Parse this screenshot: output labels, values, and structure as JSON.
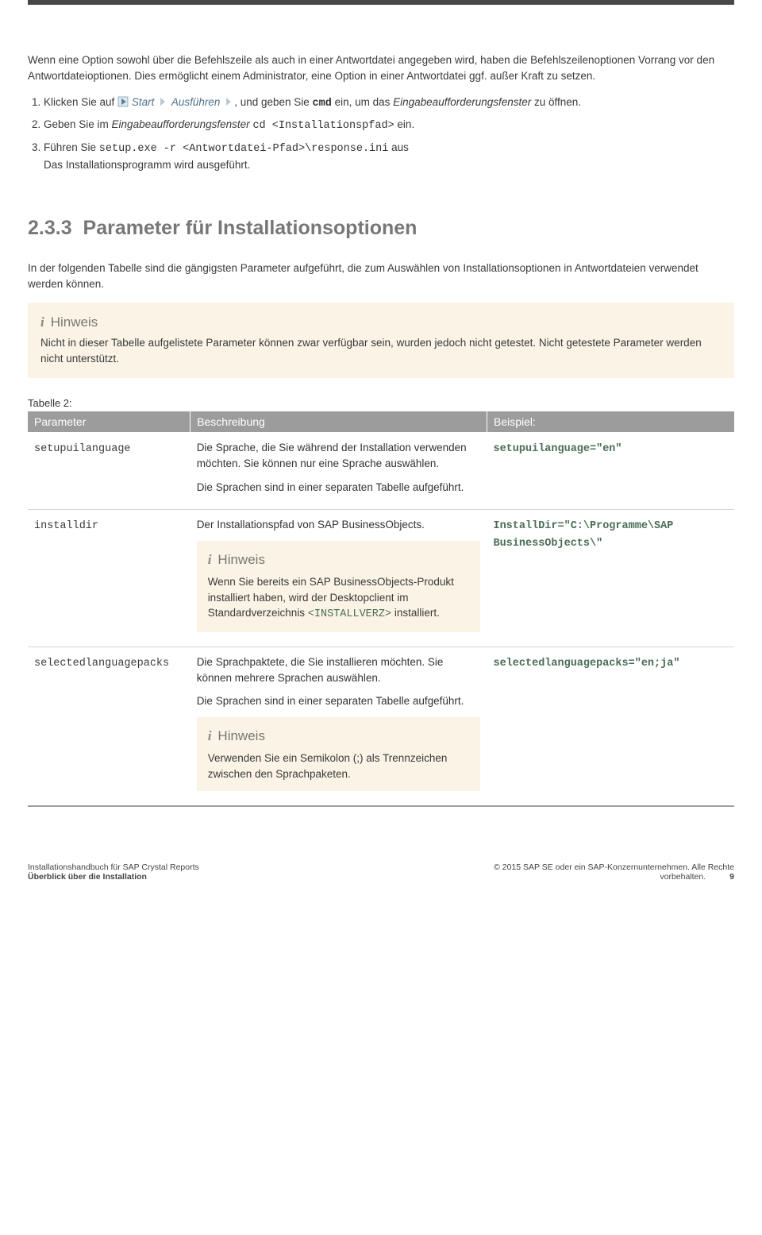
{
  "intro": {
    "p1": "Wenn eine Option sowohl über die Befehlszeile als auch in einer Antwortdatei angegeben wird, haben die Befehlszeilenoptionen Vorrang vor den Antwortdateioptionen. Dies ermöglicht einem Administrator, eine Option in einer Antwortdatei ggf. außer Kraft zu setzen."
  },
  "steps": {
    "s1_a": "Klicken Sie auf ",
    "s1_start": "Start",
    "s1_ausfuhren": "Ausführen",
    "s1_b": ", und geben Sie ",
    "s1_cmd": "cmd",
    "s1_c": " ein, um das ",
    "s1_fenster": "Eingabeaufforderungsfenster",
    "s1_d": " zu öffnen.",
    "s2_a": "Geben Sie im ",
    "s2_fenster": "Eingabeaufforderungsfenster",
    "s2_code": "cd <Installationspfad>",
    "s2_b": " ein.",
    "s3_a": "Führen Sie ",
    "s3_code": "setup.exe -r <Antwortdatei-Pfad>\\response.ini",
    "s3_b": " aus",
    "s3_line2": "Das Installationsprogramm wird ausgeführt."
  },
  "section": {
    "number": "2.3.3",
    "title": "Parameter für Installationsoptionen",
    "intro": "In der folgenden Tabelle sind die gängigsten Parameter aufgeführt, die zum Auswählen von Installationsoptionen in Antwortdateien verwendet werden können."
  },
  "top_note": {
    "label": "Hinweis",
    "body": "Nicht in dieser Tabelle aufgelistete Parameter können zwar verfügbar sein, wurden jedoch nicht getestet. Nicht getestete Parameter werden nicht unterstützt."
  },
  "table": {
    "caption": "Tabelle 2:",
    "headers": {
      "c1": "Parameter",
      "c2": "Beschreibung",
      "c3": "Beispiel:"
    },
    "rows": [
      {
        "param": "setupuilanguage",
        "desc_p1": "Die Sprache, die Sie während der Installation verwenden möchten. Sie können nur eine Sprache auswählen.",
        "desc_p2": "Die Sprachen sind in einer separaten Tabelle aufgeführt.",
        "example": "setupuilanguage=\"en\""
      },
      {
        "param": "installdir",
        "desc_p1": "Der Installationspfad von SAP BusinessObjects.",
        "note_label": "Hinweis",
        "note_body_a": "Wenn Sie bereits ein SAP BusinessObjects-Produkt installiert haben, wird der Desktopclient im Standardverzeichnis ",
        "note_code": "<INSTALLVERZ>",
        "note_body_b": " installiert.",
        "example": "InstallDir=\"C:\\Programme\\SAP BusinessObjects\\\""
      },
      {
        "param": "selectedlanguagepacks",
        "desc_p1": "Die Sprachpaktete, die Sie installieren möchten. Sie können mehrere Sprachen auswählen.",
        "desc_p2": "Die Sprachen sind in einer separaten Tabelle aufgeführt.",
        "note_label": "Hinweis",
        "note_body": "Verwenden Sie ein Semikolon (;) als Trennzeichen zwischen den Sprachpaketen.",
        "example": "selectedlanguagepacks=\"en;ja\""
      }
    ]
  },
  "footer": {
    "left_l1": "Installationshandbuch für SAP Crystal Reports",
    "left_l2": "Überblick über die Installation",
    "right_l1": "© 2015 SAP SE oder ein SAP-Konzernunternehmen. Alle Rechte",
    "right_l2": "vorbehalten.",
    "page": "9"
  }
}
